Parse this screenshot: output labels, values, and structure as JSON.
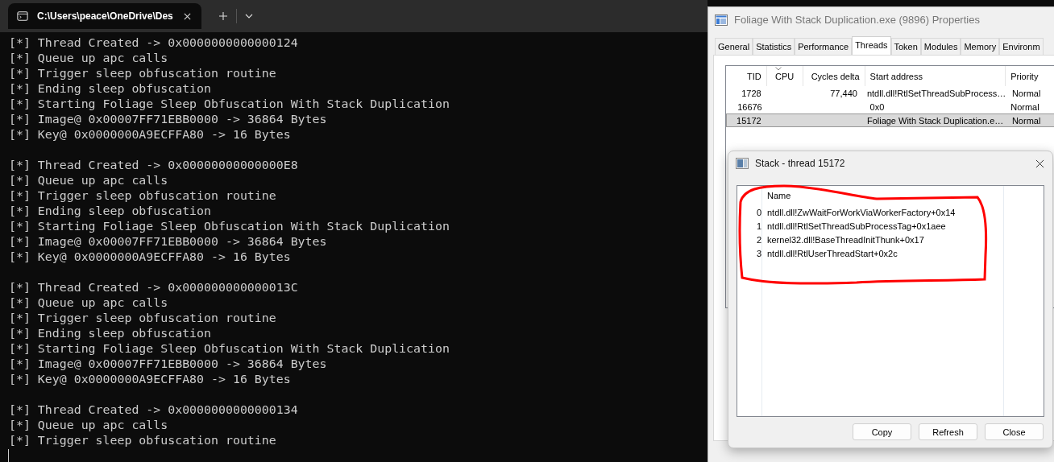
{
  "terminal": {
    "tab_title": "C:\\Users\\peace\\OneDrive\\Des",
    "blocks": [
      {
        "lines": [
          "[*] Thread Created -> 0x0000000000000124",
          "[*] Queue up apc calls",
          "[*] Trigger sleep obfuscation routine",
          "[*] Ending sleep obfuscation",
          "[*] Starting Foliage Sleep Obfuscation With Stack Duplication",
          "[*] Image@ 0x00007FF71EBB0000 -> 36864 Bytes",
          "[*] Key@ 0x0000000A9ECFFA80 -> 16 Bytes"
        ]
      },
      {
        "lines": [
          "[*] Thread Created -> 0x00000000000000E8",
          "[*] Queue up apc calls",
          "[*] Trigger sleep obfuscation routine",
          "[*] Ending sleep obfuscation",
          "[*] Starting Foliage Sleep Obfuscation With Stack Duplication",
          "[*] Image@ 0x00007FF71EBB0000 -> 36864 Bytes",
          "[*] Key@ 0x0000000A9ECFFA80 -> 16 Bytes"
        ]
      },
      {
        "lines": [
          "[*] Thread Created -> 0x000000000000013C",
          "[*] Queue up apc calls",
          "[*] Trigger sleep obfuscation routine",
          "[*] Ending sleep obfuscation",
          "[*] Starting Foliage Sleep Obfuscation With Stack Duplication",
          "[*] Image@ 0x00007FF71EBB0000 -> 36864 Bytes",
          "[*] Key@ 0x0000000A9ECFFA80 -> 16 Bytes"
        ]
      },
      {
        "lines": [
          "[*] Thread Created -> 0x0000000000000134",
          "[*] Queue up apc calls",
          "[*] Trigger sleep obfuscation routine"
        ]
      }
    ]
  },
  "properties": {
    "title": "Foliage With Stack Duplication.exe (9896) Properties",
    "tabs": [
      {
        "label": "General",
        "selected": false
      },
      {
        "label": "Statistics",
        "selected": false
      },
      {
        "label": "Performance",
        "selected": false
      },
      {
        "label": "Threads",
        "selected": true
      },
      {
        "label": "Token",
        "selected": false
      },
      {
        "label": "Modules",
        "selected": false
      },
      {
        "label": "Memory",
        "selected": false
      },
      {
        "label": "Environm",
        "selected": false
      }
    ],
    "threads": {
      "columns": [
        {
          "label": "TID",
          "sorted": false
        },
        {
          "label": "CPU",
          "sorted": true
        },
        {
          "label": "Cycles delta",
          "sorted": false
        },
        {
          "label": "Start address",
          "sorted": false
        },
        {
          "label": "Priority",
          "sorted": false
        }
      ],
      "rows": [
        {
          "tid": "1728",
          "cycles_delta": "77,440",
          "start_address": "ntdll.dll!RtlSetThreadSubProcess…",
          "priority": "Normal",
          "selected": false
        },
        {
          "tid": "16676",
          "start_address": "0x0",
          "priority": "Normal",
          "selected": false
        },
        {
          "tid": "15172",
          "start_address": "Foliage With Stack Duplication.e…",
          "priority": "Normal",
          "selected": true
        }
      ]
    }
  },
  "stack_dialog": {
    "title": "Stack - thread 15172",
    "column": "Name",
    "frames": [
      {
        "index": "0",
        "name": "ntdll.dll!ZwWaitForWorkViaWorkerFactory+0x14"
      },
      {
        "index": "1",
        "name": "ntdll.dll!RtlSetThreadSubProcessTag+0x1aee"
      },
      {
        "index": "2",
        "name": "kernel32.dll!BaseThreadInitThunk+0x17"
      },
      {
        "index": "3",
        "name": "ntdll.dll!RtlUserThreadStart+0x2c"
      }
    ],
    "buttons": [
      "Copy",
      "Refresh",
      "Close"
    ]
  }
}
